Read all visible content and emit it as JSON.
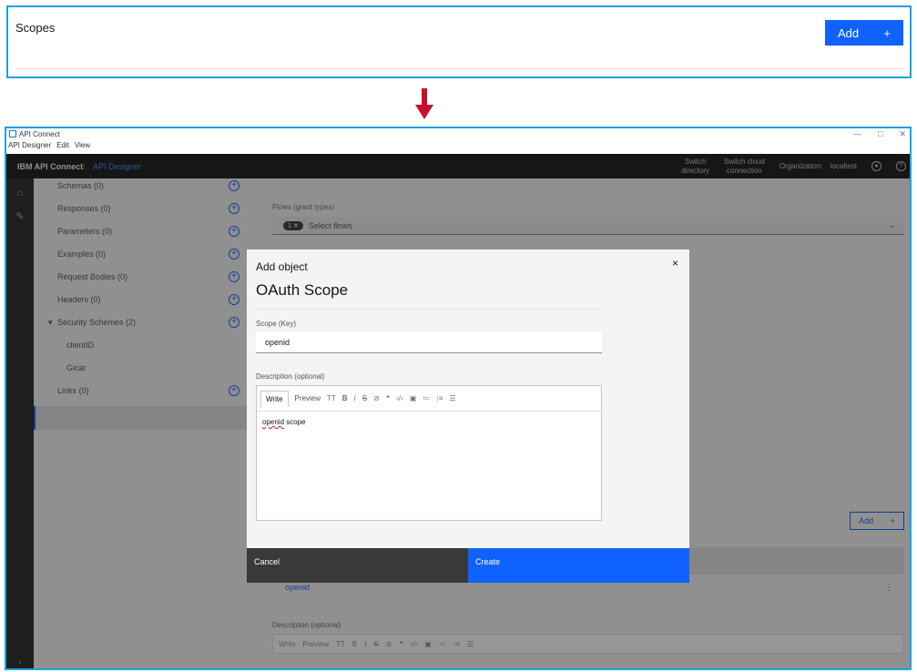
{
  "scopes_panel": {
    "title": "Scopes",
    "add_label": "Add",
    "add_icon": "+",
    "frame_color": "#1ba1e2",
    "button_color": "#0f62fe"
  },
  "arrow": {
    "color": "#c8102e",
    "icon": "down-arrow-icon"
  },
  "window": {
    "title": "API Connect",
    "controls": [
      "—",
      "□",
      "✕"
    ],
    "menus": [
      "API Designer",
      "Edit",
      "View"
    ]
  },
  "topnav": {
    "brand": "IBM API Connect",
    "separator": "|",
    "product": "API Designer",
    "switch_directory_1": "Switch",
    "switch_directory_2": "directory",
    "switch_cloud_1": "Switch cloud",
    "switch_cloud_2": "connection",
    "organization_label": "Organization:",
    "organization_value": "localtest",
    "user_icon": "user-avatar-icon",
    "help_icon": "help-icon"
  },
  "sidebar": {
    "items": [
      {
        "label": "Schemas (0)"
      },
      {
        "label": "Responses (0)"
      },
      {
        "label": "Parameters (0)"
      },
      {
        "label": "Examples (0)"
      },
      {
        "label": "Request Bodies (0)"
      },
      {
        "label": "Headers (0)"
      },
      {
        "label": "Security Schemes (2)"
      },
      {
        "label": "Links (0)"
      }
    ],
    "sub_items": [
      {
        "label": "clientID"
      },
      {
        "label": "Gicar"
      }
    ],
    "plus": "+",
    "expand_chevron": "▾"
  },
  "main": {
    "flows_label": "Flows (grant types)",
    "flows_pill": "1 ✕",
    "flows_placeholder": "Select flows",
    "flows_chevron": "⌄",
    "add_label": "Add",
    "add_icon": "+",
    "row_openid": "openid",
    "row_menu": "⋮",
    "description_label": "Description (optional)",
    "toolbar": {
      "write": "Write",
      "preview": "Preview",
      "heading": "TT",
      "bold": "B",
      "italic": "I",
      "strike": "S",
      "link": "⊘",
      "quote": "❝",
      "code": "‹/›",
      "image": "▣",
      "ul": "≔",
      "ol": "⁝≡",
      "tasks": "☰"
    }
  },
  "modal": {
    "subtitle": "Add object",
    "title": "OAuth Scope",
    "close": "×",
    "scope_label": "Scope (Key)",
    "scope_value": "openid",
    "description_label": "Description (optional)",
    "description_word1": "openid",
    "description_word2": " scope",
    "toolbar": {
      "write": "Write",
      "preview": "Preview",
      "heading": "TT",
      "bold": "B",
      "italic": "I",
      "strike": "S",
      "link": "⊘",
      "quote": "❝",
      "code": "‹/›",
      "image": "▣",
      "ul": "≔",
      "ol": "⁝≡",
      "tasks": "☰"
    },
    "cancel_label": "Cancel",
    "create_label": "Create"
  }
}
